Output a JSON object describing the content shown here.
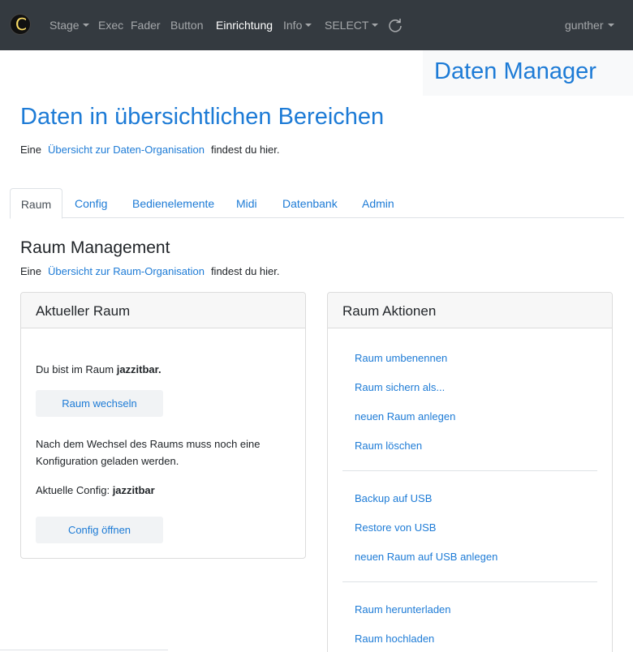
{
  "navbar": {
    "logo_letter": "C",
    "items": [
      {
        "label": "Stage",
        "dropdown": true
      },
      {
        "label": "Exec",
        "dropdown": false
      },
      {
        "label": "Fader",
        "dropdown": false
      },
      {
        "label": "Button",
        "dropdown": false
      },
      {
        "label": "Einrichtung",
        "dropdown": false,
        "active": true
      },
      {
        "label": "Info",
        "dropdown": true
      },
      {
        "label": "SELECT",
        "dropdown": true
      }
    ],
    "refresh_icon": "refresh-icon",
    "user": "gunther"
  },
  "header": {
    "manager_title": "Daten Manager"
  },
  "page": {
    "title": "Daten in übersichtlichen Bereichen",
    "intro_prefix": "Eine",
    "intro_link": "Übersicht zur Daten-Organisation",
    "intro_suffix": "findest du hier."
  },
  "tabs": [
    {
      "label": "Raum",
      "active": true
    },
    {
      "label": "Config"
    },
    {
      "label": "Bedienelemente"
    },
    {
      "label": "Midi"
    },
    {
      "label": "Datenbank"
    },
    {
      "label": "Admin"
    }
  ],
  "section": {
    "title": "Raum Management",
    "intro_prefix": "Eine",
    "intro_link": "Übersicht zur Raum-Organisation",
    "intro_suffix": "findest du hier."
  },
  "current_room": {
    "header": "Aktueller Raum",
    "room_prefix": "Du bist im Raum",
    "room_name": "jazzitbar.",
    "switch_button": "Raum wechseln",
    "note_line1": "Nach dem Wechsel des Raums muss noch eine",
    "note_line2": "Konfiguration geladen werden.",
    "config_prefix": "Aktuelle Config:",
    "config_name": "jazzitbar",
    "open_config_button": "Config öffnen"
  },
  "room_actions": {
    "header": "Raum Aktionen",
    "group1": [
      "Raum umbenennen",
      "Raum sichern als...",
      "neuen Raum anlegen",
      "Raum löschen"
    ],
    "group2": [
      "Backup auf USB",
      "Restore von USB",
      "neuen Raum auf USB anlegen"
    ],
    "group3": [
      "Raum herunterladen",
      "Raum hochladen"
    ]
  },
  "colors": {
    "navbar_bg": "#343a40",
    "link": "#1d7bd6",
    "card_header_bg": "#f7f7f7"
  }
}
